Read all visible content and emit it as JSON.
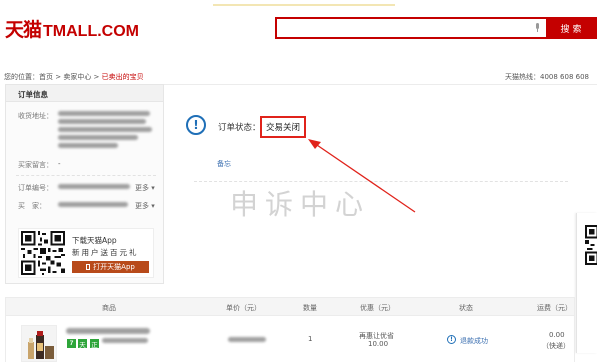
{
  "header": {
    "logo_cn": "天猫",
    "logo_en": "TMALL.COM",
    "search_placeholder": "",
    "search_button": "搜索"
  },
  "breadcrumb": {
    "prefix": "您的位置：",
    "items": [
      "首页",
      "卖家中心",
      "已卖出的宝贝"
    ],
    "separator": " > "
  },
  "hotline": "天猫热线：4008 608 608",
  "order_info": {
    "title": "订单信息",
    "address_label": "收货地址：",
    "message_label": "买家留言：",
    "message_value": "-",
    "order_no_label": "订单编号：",
    "buyer_label": "买　家：",
    "more_label": "更多",
    "app_promo_line1": "下载天猫App",
    "app_promo_line2": "新用户送百元礼",
    "open_app_button": "打开天猫App"
  },
  "order_status": {
    "label": "订单状态：",
    "value": "交易关闭",
    "remark_link": "备忘",
    "watermark": "申诉中心"
  },
  "table": {
    "headers": [
      "商品",
      "单价（元）",
      "数量",
      "优惠（元）",
      "状态",
      "运费（元）"
    ],
    "rows": [
      {
        "quantity": "1",
        "discount_label": "再惠让优省",
        "discount_value": "10.00",
        "badges": [
          "7",
          "天",
          "正"
        ],
        "refund_status": "退款成功",
        "shipping_value": "0.00",
        "shipping_note": "（快递）"
      }
    ]
  },
  "colors": {
    "brand": "#c40000",
    "status_highlight": "#e0231b",
    "link": "#3b6fb0",
    "badge_green": "#2ea53a",
    "app_button": "#b84a1a"
  }
}
